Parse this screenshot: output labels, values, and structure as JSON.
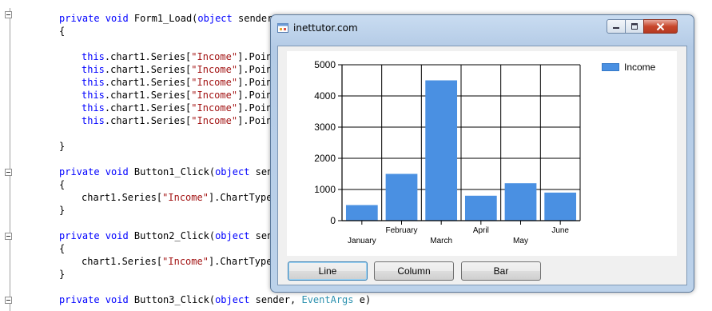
{
  "editor": {
    "lines": [
      [
        {
          "t": "private void ",
          "c": "kw"
        },
        {
          "t": "Form1_Load(",
          "c": ""
        },
        {
          "t": "object",
          "c": "kw"
        },
        {
          "t": " sender, ",
          "c": ""
        }
      ],
      [
        {
          "t": "{",
          "c": ""
        }
      ],
      [],
      [
        {
          "t": "this",
          "c": "kw"
        },
        {
          "t": ".chart1.Series[",
          "c": ""
        },
        {
          "t": "\"Income\"",
          "c": "str"
        },
        {
          "t": "].Point",
          "c": ""
        }
      ],
      [
        {
          "t": "this",
          "c": "kw"
        },
        {
          "t": ".chart1.Series[",
          "c": ""
        },
        {
          "t": "\"Income\"",
          "c": "str"
        },
        {
          "t": "].Point",
          "c": ""
        }
      ],
      [
        {
          "t": "this",
          "c": "kw"
        },
        {
          "t": ".chart1.Series[",
          "c": ""
        },
        {
          "t": "\"Income\"",
          "c": "str"
        },
        {
          "t": "].Point",
          "c": ""
        }
      ],
      [
        {
          "t": "this",
          "c": "kw"
        },
        {
          "t": ".chart1.Series[",
          "c": ""
        },
        {
          "t": "\"Income\"",
          "c": "str"
        },
        {
          "t": "].Point",
          "c": ""
        }
      ],
      [
        {
          "t": "this",
          "c": "kw"
        },
        {
          "t": ".chart1.Series[",
          "c": ""
        },
        {
          "t": "\"Income\"",
          "c": "str"
        },
        {
          "t": "].Point",
          "c": ""
        }
      ],
      [
        {
          "t": "this",
          "c": "kw"
        },
        {
          "t": ".chart1.Series[",
          "c": ""
        },
        {
          "t": "\"Income\"",
          "c": "str"
        },
        {
          "t": "].Point",
          "c": ""
        }
      ],
      [],
      [
        {
          "t": "}",
          "c": ""
        }
      ],
      [],
      [
        {
          "t": "private void ",
          "c": "kw"
        },
        {
          "t": "Button1_Click(",
          "c": ""
        },
        {
          "t": "object",
          "c": "kw"
        },
        {
          "t": " sende",
          "c": ""
        }
      ],
      [
        {
          "t": "{",
          "c": ""
        }
      ],
      [
        {
          "t": "chart1.Series[",
          "c": ""
        },
        {
          "t": "\"Income\"",
          "c": "str"
        },
        {
          "t": "].ChartType",
          "c": ""
        }
      ],
      [
        {
          "t": "}",
          "c": ""
        }
      ],
      [],
      [
        {
          "t": "private void ",
          "c": "kw"
        },
        {
          "t": "Button2_Click(",
          "c": ""
        },
        {
          "t": "object",
          "c": "kw"
        },
        {
          "t": " sende",
          "c": ""
        }
      ],
      [
        {
          "t": "{",
          "c": ""
        }
      ],
      [
        {
          "t": "chart1.Series[",
          "c": ""
        },
        {
          "t": "\"Income\"",
          "c": "str"
        },
        {
          "t": "].ChartType",
          "c": ""
        }
      ],
      [
        {
          "t": "}",
          "c": ""
        }
      ],
      [],
      [
        {
          "t": "private void ",
          "c": "kw"
        },
        {
          "t": "Button3_Click(",
          "c": ""
        },
        {
          "t": "object",
          "c": "kw"
        },
        {
          "t": " sender, ",
          "c": ""
        },
        {
          "t": "EventArgs",
          "c": "typ"
        },
        {
          "t": " e)",
          "c": ""
        }
      ]
    ],
    "indents": [
      74,
      74,
      0,
      102,
      102,
      102,
      102,
      102,
      102,
      0,
      74,
      0,
      74,
      74,
      102,
      74,
      0,
      74,
      74,
      102,
      74,
      0,
      74
    ]
  },
  "window": {
    "title": "inettutor.com",
    "icon": "form-icon",
    "minimize_icon": "minimize-icon",
    "maximize_icon": "maximize-icon",
    "close_icon": "close-icon"
  },
  "buttons": {
    "line": "Line",
    "column": "Column",
    "bar": "Bar"
  },
  "colors": {
    "bar_fill": "#4a90e2",
    "keyword": "#0000ff",
    "string": "#a31515",
    "type": "#2b91af"
  },
  "chart_data": {
    "type": "bar",
    "categories": [
      "January",
      "February",
      "March",
      "April",
      "May",
      "June"
    ],
    "series": [
      {
        "name": "Income",
        "values": [
          500,
          1500,
          4500,
          800,
          1200,
          900
        ]
      }
    ],
    "ylim": [
      0,
      5000
    ],
    "yticks": [
      0,
      1000,
      2000,
      3000,
      4000,
      5000
    ],
    "ytick_labels": [
      "0",
      "1000",
      "2000",
      "3000",
      "4000",
      "5000"
    ],
    "grid": true,
    "legend": "top-right",
    "title": "",
    "xlabel": "",
    "ylabel": ""
  }
}
